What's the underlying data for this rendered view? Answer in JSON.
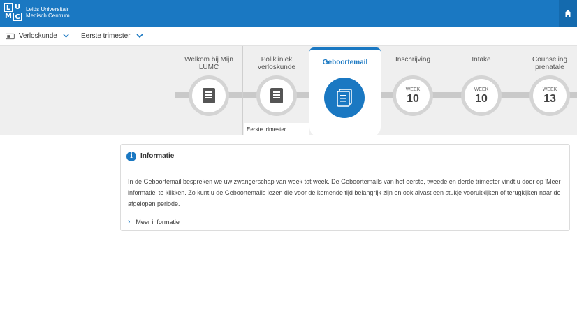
{
  "header": {
    "logo_letters": [
      "L",
      "U",
      "M",
      "C"
    ],
    "logo_line1": "Leids Universitair",
    "logo_line2": "Medisch Centrum",
    "home_icon": "home-icon"
  },
  "subbar": {
    "department": "Verloskunde",
    "trimester": "Eerste trimester"
  },
  "timeline": {
    "steps": [
      {
        "label_line1": "Welkom bij Mijn",
        "label_line2": "LUMC",
        "icon": "document-icon"
      },
      {
        "label_line1": "Polikliniek",
        "label_line2": "verloskunde",
        "icon": "document-icon"
      },
      {
        "label_line1": "Geboortemail",
        "label_line2": "",
        "icon": "document-icon",
        "active": true
      },
      {
        "label_line1": "Inschrijving",
        "label_line2": "",
        "week_word": "WEEK",
        "week": "10"
      },
      {
        "label_line1": "Intake",
        "label_line2": "",
        "week_word": "WEEK",
        "week": "10"
      },
      {
        "label_line1": "Counseling",
        "label_line2": "prenatale",
        "week_word": "WEEK",
        "week": "13"
      }
    ],
    "trimester_tag": "Eerste trimester"
  },
  "info": {
    "title": "Informatie",
    "body": "In de Geboortemail bespreken we uw zwangerschap van week tot week. De Geboortemails van het eerste, tweede en derde trimester vindt u door op 'Meer informatie' te klikken. Zo kunt u de Geboortemails lezen die voor de komende tijd belangrijk zijn en ook alvast een stukje vooruitkijken of terugkijken naar de afgelopen periode.",
    "more_label": "Meer informatie"
  },
  "colors": {
    "brand": "#1a78c2",
    "timeline_bg": "#efefef"
  }
}
